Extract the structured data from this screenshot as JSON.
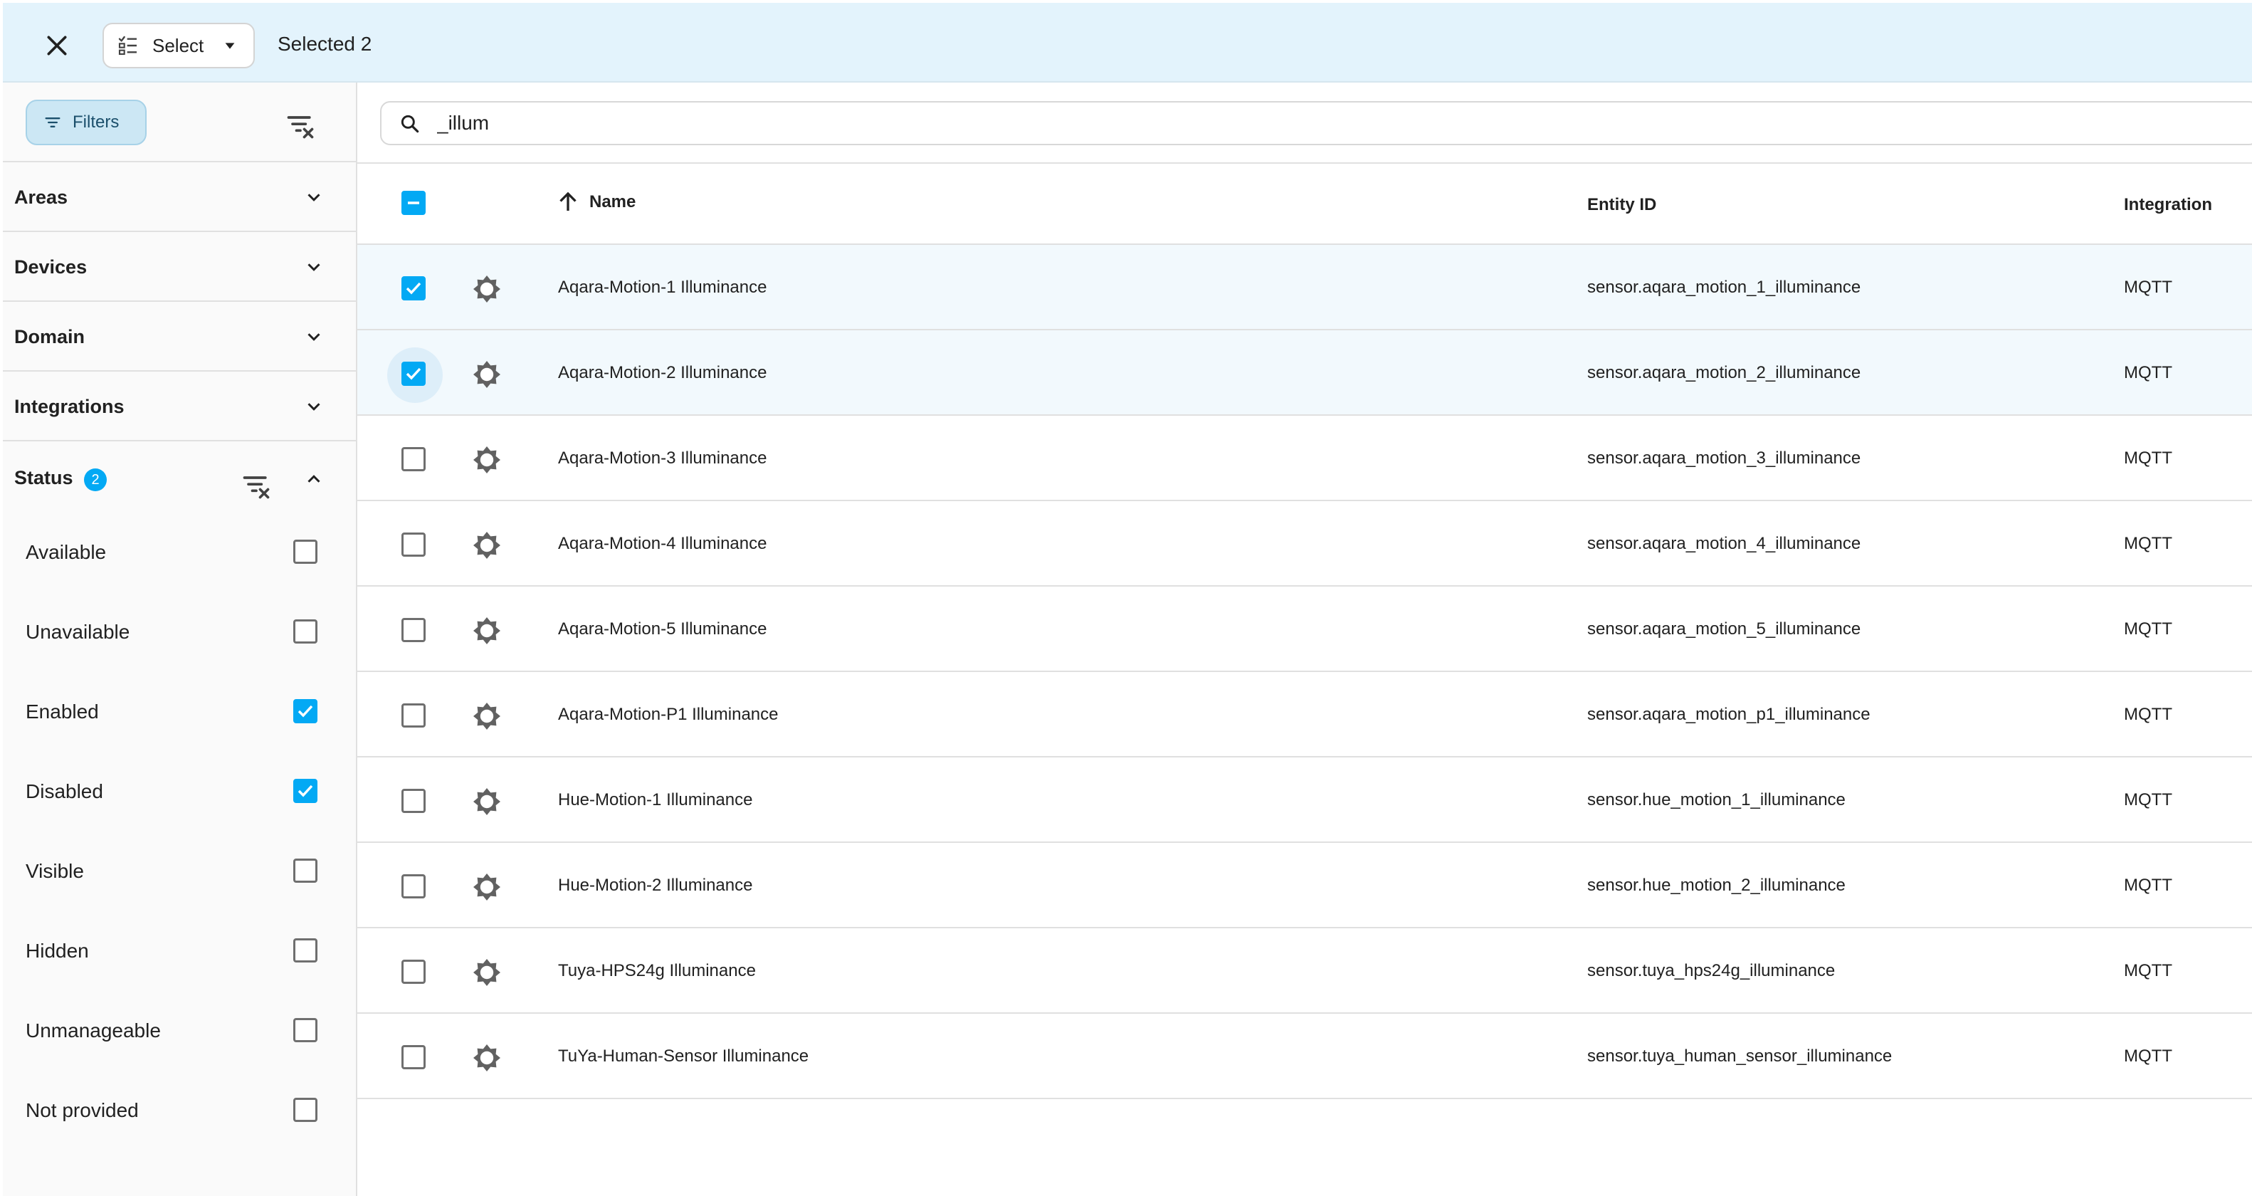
{
  "topbar": {
    "select_label": "Select",
    "selected_text": "Selected 2"
  },
  "filters": {
    "chip_label": "Filters",
    "sections": [
      {
        "title": "Areas"
      },
      {
        "title": "Devices"
      },
      {
        "title": "Domain"
      },
      {
        "title": "Integrations"
      }
    ],
    "status": {
      "title": "Status",
      "badge": "2",
      "items": [
        {
          "label": "Available",
          "checked": false
        },
        {
          "label": "Unavailable",
          "checked": false
        },
        {
          "label": "Enabled",
          "checked": true
        },
        {
          "label": "Disabled",
          "checked": true
        },
        {
          "label": "Visible",
          "checked": false
        },
        {
          "label": "Hidden",
          "checked": false
        },
        {
          "label": "Unmanageable",
          "checked": false
        },
        {
          "label": "Not provided",
          "checked": false
        }
      ]
    }
  },
  "search": {
    "value": "_illum"
  },
  "table": {
    "columns": {
      "name": "Name",
      "entity_id": "Entity ID",
      "integration": "Integration"
    },
    "header_checkbox_state": "indeterminate",
    "rows": [
      {
        "name": "Aqara-Motion-1 Illuminance",
        "entity_id": "sensor.aqara_motion_1_illuminance",
        "integration": "MQTT",
        "checked": true
      },
      {
        "name": "Aqara-Motion-2 Illuminance",
        "entity_id": "sensor.aqara_motion_2_illuminance",
        "integration": "MQTT",
        "checked": true
      },
      {
        "name": "Aqara-Motion-3 Illuminance",
        "entity_id": "sensor.aqara_motion_3_illuminance",
        "integration": "MQTT",
        "checked": false
      },
      {
        "name": "Aqara-Motion-4 Illuminance",
        "entity_id": "sensor.aqara_motion_4_illuminance",
        "integration": "MQTT",
        "checked": false
      },
      {
        "name": "Aqara-Motion-5 Illuminance",
        "entity_id": "sensor.aqara_motion_5_illuminance",
        "integration": "MQTT",
        "checked": false
      },
      {
        "name": "Aqara-Motion-P1 Illuminance",
        "entity_id": "sensor.aqara_motion_p1_illuminance",
        "integration": "MQTT",
        "checked": false
      },
      {
        "name": "Hue-Motion-1 Illuminance",
        "entity_id": "sensor.hue_motion_1_illuminance",
        "integration": "MQTT",
        "checked": false
      },
      {
        "name": "Hue-Motion-2 Illuminance",
        "entity_id": "sensor.hue_motion_2_illuminance",
        "integration": "MQTT",
        "checked": false
      },
      {
        "name": "Tuya-HPS24g Illuminance",
        "entity_id": "sensor.tuya_hps24g_illuminance",
        "integration": "MQTT",
        "checked": false
      },
      {
        "name": "TuYa-Human-Sensor Illuminance",
        "entity_id": "sensor.tuya_human_sensor_illuminance",
        "integration": "MQTT",
        "checked": false
      }
    ]
  },
  "colors": {
    "accent": "#03a9f4",
    "topbar_bg": "#e3f3fc",
    "selected_row_bg": "#f2f9fd"
  },
  "icons": {
    "close": "close-icon",
    "select": "select-list-icon",
    "filter": "filter-icon",
    "clear_filter": "filter-remove-icon",
    "chevron_down": "chevron-down-icon",
    "chevron_up": "chevron-up-icon",
    "search": "search-icon",
    "sort": "arrow-up-icon",
    "entity": "brightness-icon"
  }
}
